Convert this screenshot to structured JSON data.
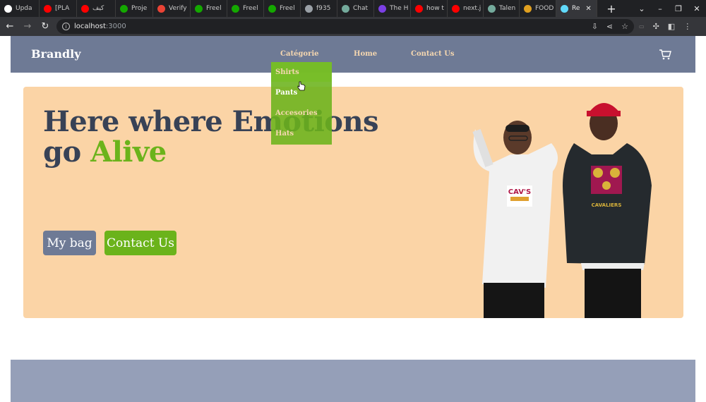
{
  "browser": {
    "tabs": [
      {
        "label": "Upda",
        "icon": "github-icon",
        "color": "#ffffff"
      },
      {
        "label": "[PLA",
        "icon": "youtube-icon",
        "color": "#ff0000"
      },
      {
        "label": "كيف",
        "icon": "youtube-icon",
        "color": "#ff0000"
      },
      {
        "label": "Proje",
        "icon": "upwork-icon",
        "color": "#14a800"
      },
      {
        "label": "Verify",
        "icon": "gmail-icon",
        "color": "#ea4335"
      },
      {
        "label": "Freel",
        "icon": "upwork-icon",
        "color": "#14a800"
      },
      {
        "label": "Freel",
        "icon": "upwork-icon",
        "color": "#14a800"
      },
      {
        "label": "Freel",
        "icon": "upwork-icon",
        "color": "#14a800"
      },
      {
        "label": "f935",
        "icon": "globe-icon",
        "color": "#9aa0a6"
      },
      {
        "label": "Chat",
        "icon": "chatgpt-icon",
        "color": "#74aa9c"
      },
      {
        "label": "The H",
        "icon": "site-icon",
        "color": "#7b3fe4"
      },
      {
        "label": "how t",
        "icon": "youtube-icon",
        "color": "#ff0000"
      },
      {
        "label": "next.j",
        "icon": "youtube-icon",
        "color": "#ff0000"
      },
      {
        "label": "Talen",
        "icon": "chatgpt-icon",
        "color": "#74aa9c"
      },
      {
        "label": "FOOD",
        "icon": "site-icon",
        "color": "#e0a020"
      },
      {
        "label": "Re",
        "icon": "react-icon",
        "color": "#61dafb",
        "active": true
      }
    ],
    "url_host": "localhost",
    "url_port": ":3000"
  },
  "navbar": {
    "brand": "Brandly",
    "links": [
      "Catégorie",
      "Home",
      "Contact Us"
    ]
  },
  "dropdown": {
    "items": [
      "Shirts",
      "Pants",
      "Accesories",
      "Hats"
    ]
  },
  "hero": {
    "headline_part1": "Here where Emotions",
    "headline_part2": "go ",
    "headline_accent": "Alive",
    "bag_button": "My bag",
    "contact_button": "Contact Us"
  },
  "colors": {
    "navbar_bg": "#6e7a95",
    "nav_link": "#f5d7b0",
    "hero_bg": "#fbd4a6",
    "accent_green": "#6bb31b",
    "headline": "#384256",
    "footer_band": "#959fb8"
  }
}
